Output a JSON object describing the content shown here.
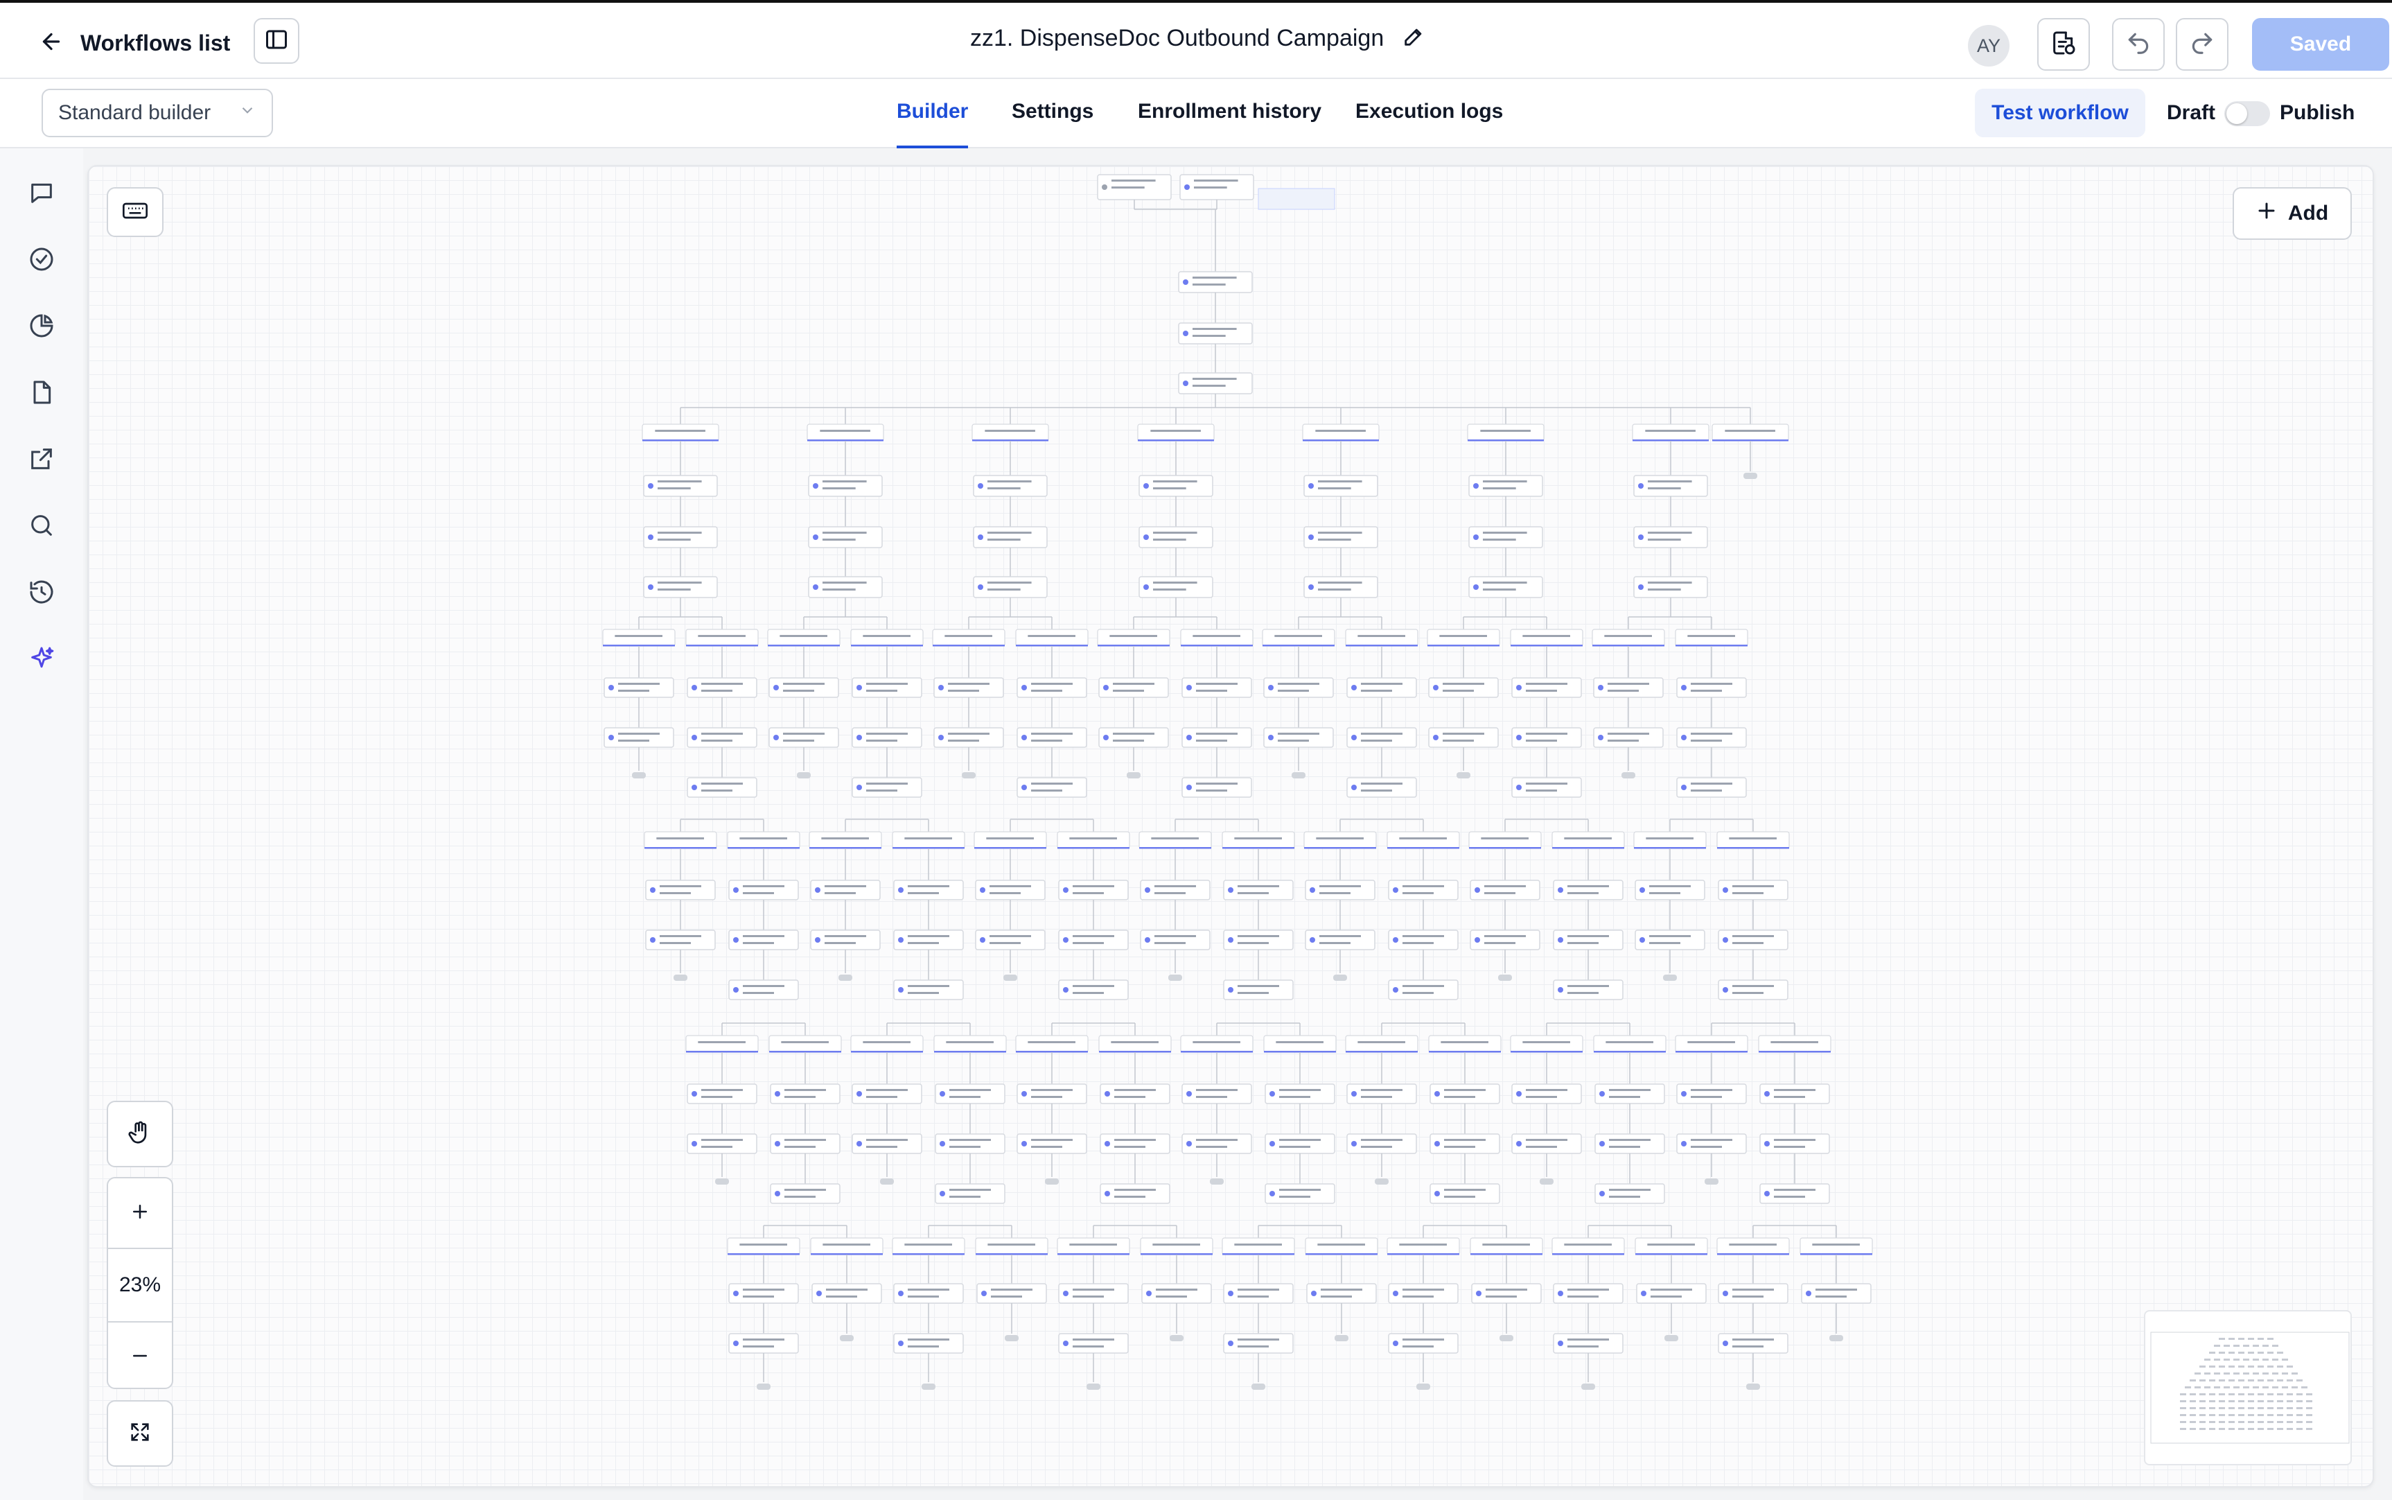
{
  "header": {
    "back_label": "Workflows list",
    "workflow_title": "zz1. DispenseDoc Outbound Campaign",
    "avatar_initials": "AY",
    "saved_label": "Saved"
  },
  "subheader": {
    "builder_select_value": "Standard builder",
    "tabs": [
      {
        "label": "Builder",
        "active": true
      },
      {
        "label": "Settings",
        "active": false
      },
      {
        "label": "Enrollment history",
        "active": false
      },
      {
        "label": "Execution logs",
        "active": false
      }
    ],
    "test_label": "Test workflow",
    "draft_label": "Draft",
    "publish_label": "Publish",
    "publish_enabled": false
  },
  "left_nav": {
    "icons": [
      "comment-icon",
      "check-circle-icon",
      "pie-chart-icon",
      "document-icon",
      "external-link-icon",
      "search-icon",
      "history-icon",
      "sparkle-icon"
    ]
  },
  "canvas": {
    "add_label": "Add",
    "zoom_level": "23%",
    "accent_color": "#1d4ed8",
    "saved_color": "#a3bdf7"
  }
}
